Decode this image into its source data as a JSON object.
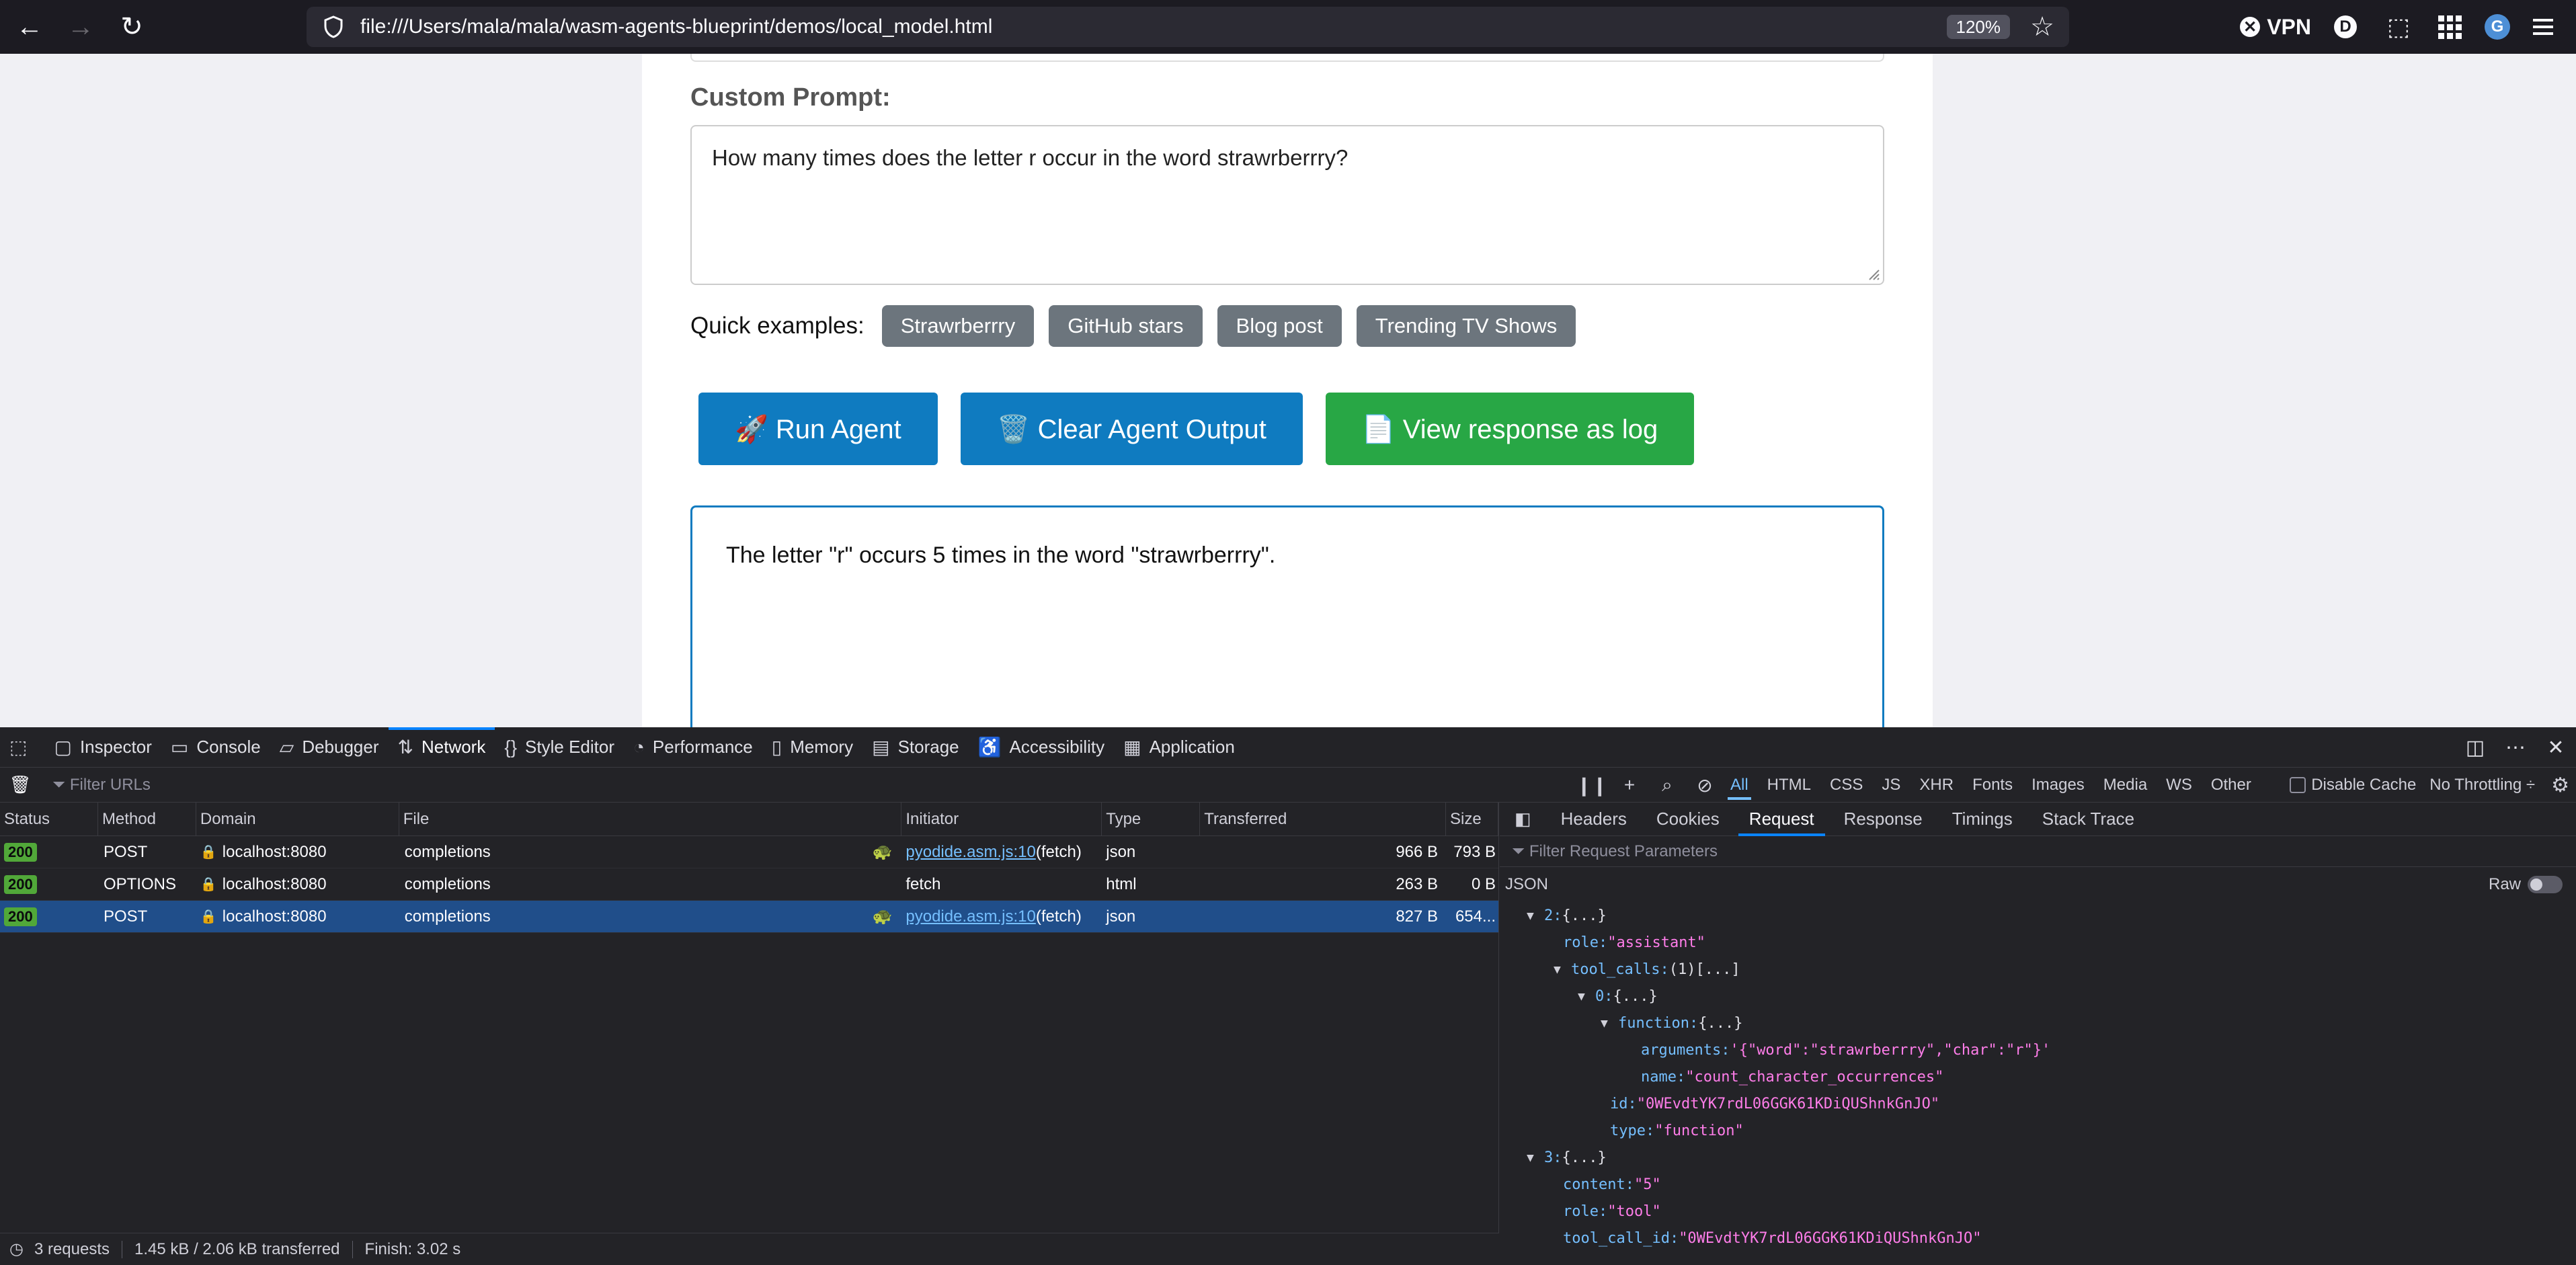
{
  "browser": {
    "url": "file:///Users/mala/mala/wasm-agents-blueprint/demos/local_model.html",
    "zoom": "120%",
    "vpn_label": "VPN",
    "account_initial": "D"
  },
  "page": {
    "custom_prompt_label": "Custom Prompt:",
    "prompt_text": "How many times does the letter r occur in the word strawrberrry?",
    "quick_examples_label": "Quick examples:",
    "quick_examples": [
      "Strawrberrry",
      "GitHub stars",
      "Blog post",
      "Trending TV Shows"
    ],
    "buttons": {
      "run": "🚀 Run Agent",
      "clear": "🗑️ Clear Agent Output",
      "log": "📄 View response as log"
    },
    "output_text": "The letter \"r\" occurs 5 times in the word \"strawrberrry\"."
  },
  "devtools": {
    "tabs": [
      "Inspector",
      "Console",
      "Debugger",
      "Network",
      "Style Editor",
      "Performance",
      "Memory",
      "Storage",
      "Accessibility",
      "Application"
    ],
    "active_tab": "Network",
    "filter_placeholder": "Filter URLs",
    "type_filters": [
      "All",
      "HTML",
      "CSS",
      "JS",
      "XHR",
      "Fonts",
      "Images",
      "Media",
      "WS",
      "Other"
    ],
    "disable_cache": "Disable Cache",
    "throttling": "No Throttling ÷",
    "columns": [
      "Status",
      "Method",
      "Domain",
      "File",
      "Initiator",
      "Type",
      "Transferred",
      "Size"
    ],
    "requests": [
      {
        "status": "200",
        "method": "POST",
        "domain": "localhost:8080",
        "file": "completions",
        "initiator": "pyodide.asm.js:10",
        "initiator_suffix": " (fetch)",
        "type": "json",
        "transferred": "966 B",
        "size": "793 B"
      },
      {
        "status": "200",
        "method": "OPTIONS",
        "domain": "localhost:8080",
        "file": "completions",
        "initiator": "",
        "initiator_suffix": "fetch",
        "type": "html",
        "transferred": "263 B",
        "size": "0 B"
      },
      {
        "status": "200",
        "method": "POST",
        "domain": "localhost:8080",
        "file": "completions",
        "initiator": "pyodide.asm.js:10",
        "initiator_suffix": " (fetch)",
        "type": "json",
        "transferred": "827 B",
        "size": "654..."
      }
    ],
    "side_tabs": [
      "Headers",
      "Cookies",
      "Request",
      "Response",
      "Timings",
      "Stack Trace"
    ],
    "active_side_tab": "Request",
    "request_filter_placeholder": "Filter Request Parameters",
    "json_label": "JSON",
    "raw_label": "Raw",
    "tree": [
      {
        "indent": 0,
        "tri": "▼",
        "key": "2:",
        "val": "",
        "rest": " {...}"
      },
      {
        "indent": 1,
        "tri": "",
        "key": "role:",
        "val": " \"assistant\"",
        "rest": ""
      },
      {
        "indent": 1,
        "tri": "▼",
        "key": "tool_calls:",
        "val": "",
        "rest": " (1)[...]"
      },
      {
        "indent": 2,
        "tri": "▼",
        "key": "0:",
        "val": "",
        "rest": " {...}"
      },
      {
        "indent": 3,
        "tri": "▼",
        "key": "function:",
        "val": "",
        "rest": " {...}"
      },
      {
        "indent": 4,
        "tri": "",
        "key": "arguments:",
        "val": " '{\"word\":\"strawrberrry\",\"char\":\"r\"}'",
        "rest": ""
      },
      {
        "indent": 4,
        "tri": "",
        "key": "name:",
        "val": " \"count_character_occurrences\"",
        "rest": ""
      },
      {
        "indent": 3,
        "tri": "",
        "key": "id:",
        "val": " \"0WEvdtYK7rdL06GGK61KDiQUShnkGnJO\"",
        "rest": ""
      },
      {
        "indent": 3,
        "tri": "",
        "key": "type:",
        "val": " \"function\"",
        "rest": ""
      },
      {
        "indent": 0,
        "tri": "▼",
        "key": "3:",
        "val": "",
        "rest": " {...}"
      },
      {
        "indent": 1,
        "tri": "",
        "key": "content:",
        "val": " \"5\"",
        "rest": ""
      },
      {
        "indent": 1,
        "tri": "",
        "key": "role:",
        "val": " \"tool\"",
        "rest": ""
      },
      {
        "indent": 1,
        "tri": "",
        "key": "tool_call_id:",
        "val": " \"0WEvdtYK7rdL06GGK61KDiQUShnkGnJO\"",
        "rest": ""
      }
    ],
    "status_bar": {
      "requests": "3 requests",
      "size": "1.45 kB / 2.06 kB transferred",
      "finish": "Finish: 3.02 s"
    }
  }
}
